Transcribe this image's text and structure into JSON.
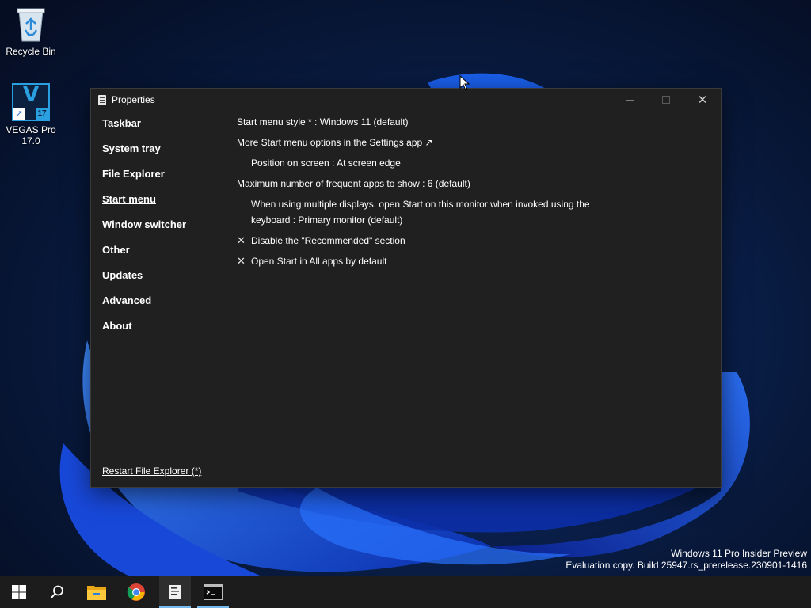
{
  "desktop": {
    "icons": [
      {
        "label": "Recycle Bin"
      },
      {
        "label": "VEGAS Pro 17.0",
        "badge": "17",
        "glyph": "V"
      }
    ]
  },
  "window": {
    "title": "Properties",
    "close_glyph": "✕",
    "sidebar": {
      "items": [
        {
          "label": "Taskbar",
          "active": false
        },
        {
          "label": "System tray",
          "active": false
        },
        {
          "label": "File Explorer",
          "active": false
        },
        {
          "label": "Start menu",
          "active": true
        },
        {
          "label": "Window switcher",
          "active": false
        },
        {
          "label": "Other",
          "active": false
        },
        {
          "label": "Updates",
          "active": false
        },
        {
          "label": "Advanced",
          "active": false
        },
        {
          "label": "About",
          "active": false
        }
      ],
      "restart_link": "Restart File Explorer (*)"
    },
    "options": {
      "start_menu_style": "Start menu style * : Windows 11 (default)",
      "more_options": "More Start menu options in the Settings app ↗",
      "position": "Position on screen : At screen edge",
      "max_frequent": "Maximum number of frequent apps to show : 6 (default)",
      "multi_display": "When using multiple displays, open Start on this monitor when invoked using the keyboard : Primary monitor (default)",
      "disable_recommended": "Disable the \"Recommended\" section",
      "open_all_apps": "Open Start in All apps by default",
      "check_glyph": "✕"
    }
  },
  "watermark": {
    "line1": "Windows 11 Pro Insider Preview",
    "line2": "Evaluation copy. Build 25947.rs_prerelease.230901-1416"
  },
  "taskbar": {
    "items": [
      "start-icon",
      "search-icon",
      "file-explorer-icon",
      "chrome-icon",
      "explorerpatcher-icon",
      "terminal-icon"
    ]
  },
  "colors": {
    "window_bg": "#202020",
    "taskbar_bg": "#1c1c1c",
    "wallpaper_base": "#081a3c",
    "accent": "#1a64e8"
  }
}
